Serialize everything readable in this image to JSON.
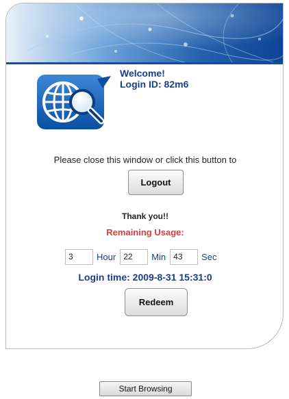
{
  "welcome": {
    "greeting": "Welcome!",
    "login_id_label": "Login ID:",
    "login_id_value": "82m6"
  },
  "logout_section": {
    "message": "Please close this window or click this button to",
    "logout_label": "Logout"
  },
  "usage": {
    "thanks": "Thank you!!",
    "remaining_label": "Remaining Usage:",
    "hours": "3",
    "hour_unit": "Hour",
    "minutes": "22",
    "min_unit": "Min",
    "seconds": "43",
    "sec_unit": "Sec",
    "login_time": "Login time: 2009-8-31 15:31:0",
    "redeem_label": "Redeem"
  },
  "footer": {
    "start_browsing_label": "Start Browsing"
  },
  "colors": {
    "heading_blue": "#1b3c8c",
    "alert_red": "#e23a3a",
    "banner_blue": "#0f4ea1"
  }
}
